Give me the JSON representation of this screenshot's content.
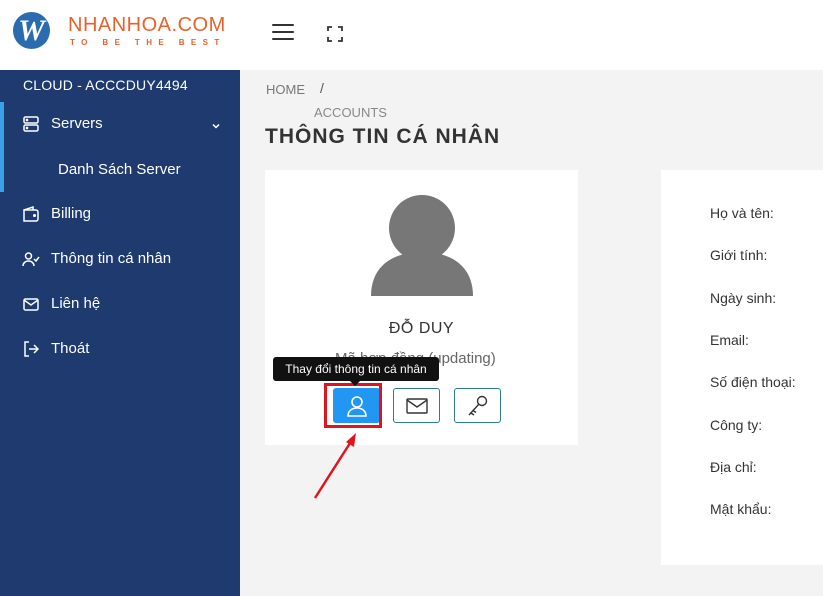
{
  "header": {
    "logo_letter": "W",
    "brand": "NHANHOA.COM",
    "tagline": "TO BE THE BEST",
    "menu_icon": "hamburger-icon",
    "fullscreen_icon": "fullscreen-icon"
  },
  "sidebar": {
    "account": "CLOUD - ACCCDUY4494",
    "items": [
      {
        "label": "Servers",
        "icon": "server-icon"
      },
      {
        "label": "Danh Sách Server"
      },
      {
        "label": "Billing",
        "icon": "wallet-icon"
      },
      {
        "label": "Thông tin cá nhân",
        "icon": "user-check-icon"
      },
      {
        "label": "Liên hệ",
        "icon": "mail-icon"
      },
      {
        "label": "Thoát",
        "icon": "logout-icon"
      }
    ]
  },
  "breadcrumb": {
    "home": "HOME",
    "separator": "/",
    "current": "ACCOUNTS"
  },
  "page": {
    "title": "THÔNG TIN CÁ NHÂN"
  },
  "profile": {
    "name": "ĐỖ DUY",
    "subtitle": "Mã hợp đồng (updating)",
    "tooltip": "Thay đổi thông tin cá nhân",
    "buttons": [
      "user-icon",
      "envelope-icon",
      "key-icon"
    ]
  },
  "info": {
    "labels": [
      "Họ và tên:",
      "Giới tính:",
      "Ngày sinh:",
      "Email:",
      "Số điện thoại:",
      "Công ty:",
      "Địa chỉ:",
      "Mật khẩu:"
    ]
  },
  "colors": {
    "sidebar_bg": "#1e3a6e",
    "accent": "#2196f3",
    "brand": "#e8622c",
    "highlight": "#e0141e"
  }
}
